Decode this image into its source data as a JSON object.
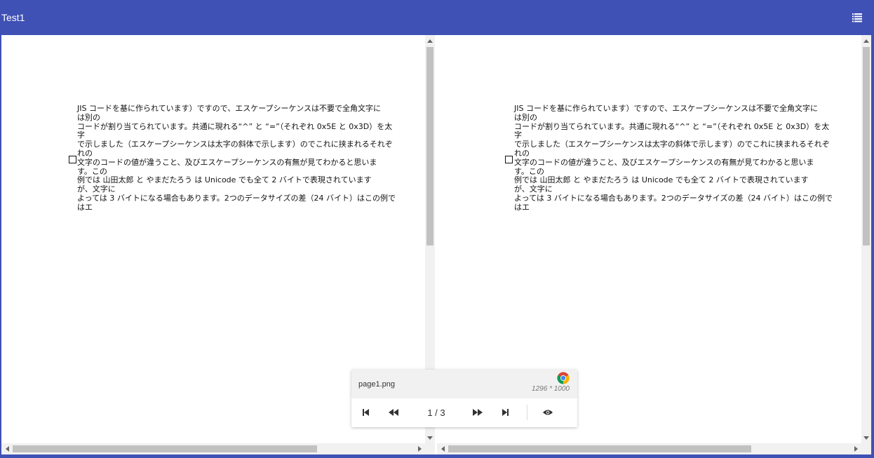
{
  "app": {
    "title": "Test1",
    "menu_icon": "list-icon"
  },
  "panes": [
    {
      "lines": [
        "JIS コードを基に作られています）ですので、エスケープシーケンスは不要で全角文字に",
        "は別の",
        "コードが割り当てられています。共通に現れる“^” と “=”（それぞれ 0x5E と 0x3D）を太",
        "字",
        "で示しました（エスケープシーケンスは太字の斜体で示します）のでこれに挟まれるそれぞ",
        "れの",
        "文字のコードの値が違うこと、及びエスケープシーケンスの有無が見てわかると思いま",
        "す。この",
        "例では 山田太郎 と やまだたろう は Unicode でも全て 2 バイトで表現されています",
        "が、文字に",
        "よっては 3 バイトになる場合もあります。2つのデータサイズの差（24 バイト）はこの例で",
        "はエ"
      ]
    },
    {
      "lines": [
        "JIS コードを基に作られています）ですので、エスケープシーケンスは不要で全角文字に",
        "は別の",
        "コードが割り当てられています。共通に現れる“^” と “=”（それぞれ 0x5E と 0x3D）を太",
        "字",
        "で示しました（エスケープシーケンスは太字の斜体で示します）のでこれに挟まれるそれぞ",
        "れの",
        "文字のコードの値が違うこと、及びエスケープシーケンスの有無が見てわかると思いま",
        "す。この",
        "例では 山田太郎 と やまだたろう は Unicode でも全て 2 バイトで表現されています",
        "が、文字に",
        "よっては 3 バイトになる場合もあります。2つのデータサイズの差（24 バイト）はこの例で",
        "はエ"
      ]
    }
  ],
  "viewer": {
    "file_name": "page1.png",
    "dimensions": "1296 * 1000",
    "page_indicator": "1 / 3",
    "browser_icon": "chrome-icon",
    "controls": [
      "first-page-icon",
      "previous-page-icon",
      "next-page-icon",
      "last-page-icon",
      "eye-icon"
    ]
  },
  "colors": {
    "app_bar": "#3f51b5",
    "scroll_thumb": "#c1c1c1",
    "scroll_track": "#f1f1f1"
  }
}
